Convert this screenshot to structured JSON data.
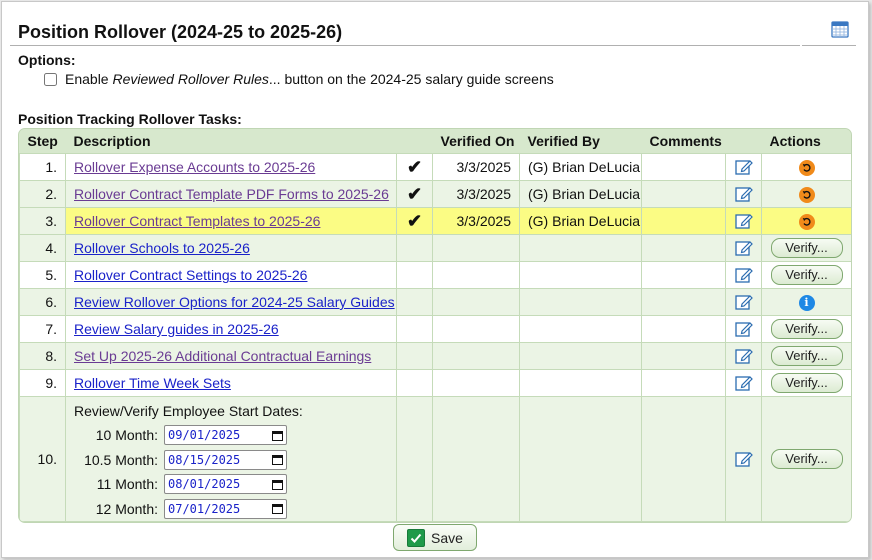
{
  "title": "Position Rollover (2024-25 to 2025-26)",
  "options_label": "Options:",
  "option_enable": {
    "prefix": "Enable ",
    "italic": "Reviewed Rollover Rules",
    "suffix": "... button on the 2024-25 salary guide screens",
    "checked": false
  },
  "tasks_label": "Position Tracking Rollover Tasks:",
  "columns": {
    "step": "Step",
    "description": "Description",
    "verified_on": "Verified On",
    "verified_by": "Verified By",
    "comments": "Comments",
    "actions": "Actions"
  },
  "rows": [
    {
      "step": "1.",
      "desc": "Rollover Expense Accounts to 2025-26",
      "check": "✔",
      "date": "3/3/2025",
      "by": "(G) Brian DeLucia",
      "action": "undo"
    },
    {
      "step": "2.",
      "desc": "Rollover Contract Template PDF Forms to 2025-26",
      "check": "✔",
      "date": "3/3/2025",
      "by": "(G) Brian DeLucia",
      "action": "undo"
    },
    {
      "step": "3.",
      "desc": "Rollover Contract Templates to 2025-26",
      "check": "✔",
      "date": "3/3/2025",
      "by": "(G) Brian DeLucia",
      "action": "undo"
    },
    {
      "step": "4.",
      "desc": "Rollover Schools to 2025-26",
      "action": "verify"
    },
    {
      "step": "5.",
      "desc": "Rollover Contract Settings to 2025-26",
      "action": "verify"
    },
    {
      "step": "6.",
      "desc": "Review Rollover Options for 2024-25 Salary Guides",
      "action": "info"
    },
    {
      "step": "7.",
      "desc": "Review Salary guides in 2025-26",
      "action": "verify"
    },
    {
      "step": "8.",
      "desc": "Set Up 2025-26 Additional Contractual Earnings",
      "action": "verify"
    },
    {
      "step": "9.",
      "desc": "Rollover Time Week Sets",
      "action": "verify"
    }
  ],
  "step10": {
    "step": "10.",
    "title": "Review/Verify Employee Start Dates:",
    "dates": [
      {
        "label": "10 Month:",
        "value": "09/01/2025"
      },
      {
        "label": "10.5 Month:",
        "value": "08/15/2025"
      },
      {
        "label": "11 Month:",
        "value": "08/01/2025"
      },
      {
        "label": "12 Month:",
        "value": "07/01/2025"
      }
    ]
  },
  "verify_label": "Verify...",
  "info_glyph": "i",
  "save_label": "Save",
  "colors": {
    "header_bg": "#d7e8cd",
    "highlight": "#fbfc84",
    "link": "#1a22c9",
    "visited": "#6a3b93"
  }
}
